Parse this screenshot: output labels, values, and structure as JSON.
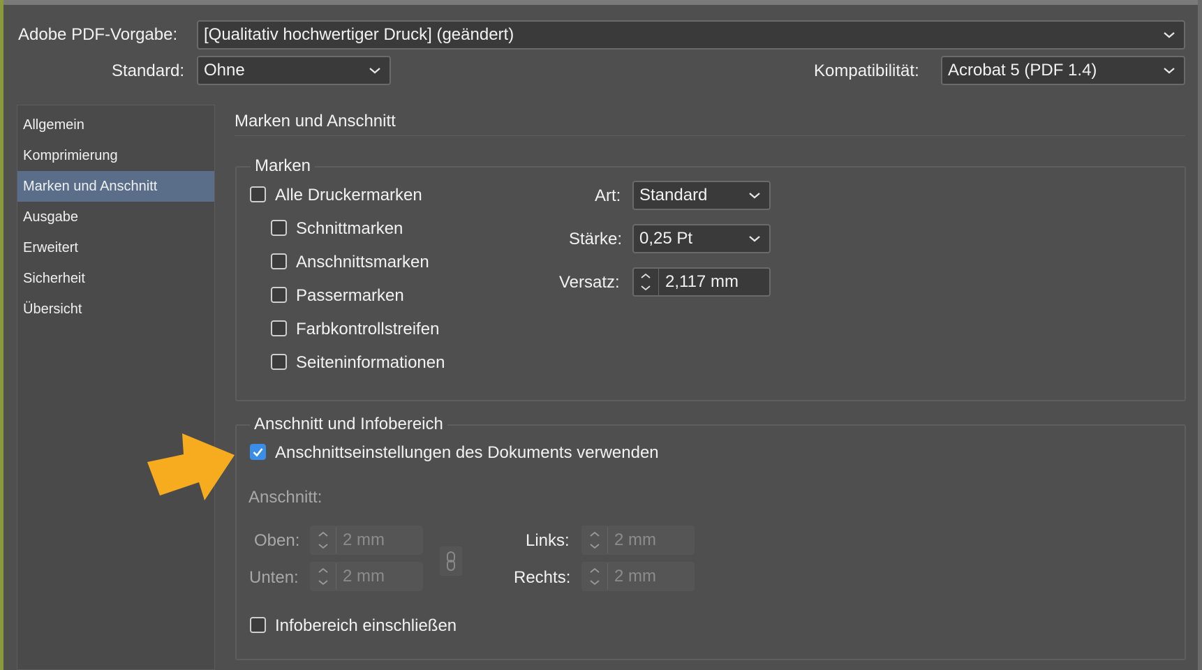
{
  "header": {
    "preset_label": "Adobe PDF-Vorgabe:",
    "preset_value": "[Qualitativ hochwertiger Druck] (geändert)",
    "standard_label": "Standard:",
    "standard_value": "Ohne",
    "compat_label": "Kompatibilität:",
    "compat_value": "Acrobat 5 (PDF 1.4)"
  },
  "sidebar": {
    "items": [
      {
        "label": "Allgemein"
      },
      {
        "label": "Komprimierung"
      },
      {
        "label": "Marken und Anschnitt"
      },
      {
        "label": "Ausgabe"
      },
      {
        "label": "Erweitert"
      },
      {
        "label": "Sicherheit"
      },
      {
        "label": "Übersicht"
      }
    ],
    "active": "Marken und Anschnitt"
  },
  "main": {
    "title": "Marken und Anschnitt",
    "marks": {
      "legend": "Marken",
      "all_printer_marks": "Alle Druckermarken",
      "items": [
        {
          "label": "Schnittmarken",
          "checked": false
        },
        {
          "label": "Anschnittsmarken",
          "checked": false
        },
        {
          "label": "Passermarken",
          "checked": false
        },
        {
          "label": "Farbkontrollstreifen",
          "checked": false
        },
        {
          "label": "Seiteninformationen",
          "checked": false
        }
      ],
      "type_label": "Art:",
      "type_value": "Standard",
      "weight_label": "Stärke:",
      "weight_value": "0,25 Pt",
      "offset_label": "Versatz:",
      "offset_value": "2,117 mm"
    },
    "bleed": {
      "legend": "Anschnitt und Infobereich",
      "use_document_label": "Anschnittseinstellungen des Dokuments verwenden",
      "use_document_checked": true,
      "bleed_label": "Anschnitt:",
      "top_label": "Oben:",
      "top_value": "2 mm",
      "bottom_label": "Unten:",
      "bottom_value": "2 mm",
      "left_label": "Links:",
      "left_value": "2 mm",
      "right_label": "Rechts:",
      "right_value": "2 mm",
      "slug_label": "Infobereich einschließen",
      "slug_checked": false
    }
  },
  "colors": {
    "background": "#4f4f4f",
    "selection": "#5a6e8a",
    "checkbox_checked": "#3b8ee8",
    "annotation_arrow": "#f6ac1e"
  }
}
